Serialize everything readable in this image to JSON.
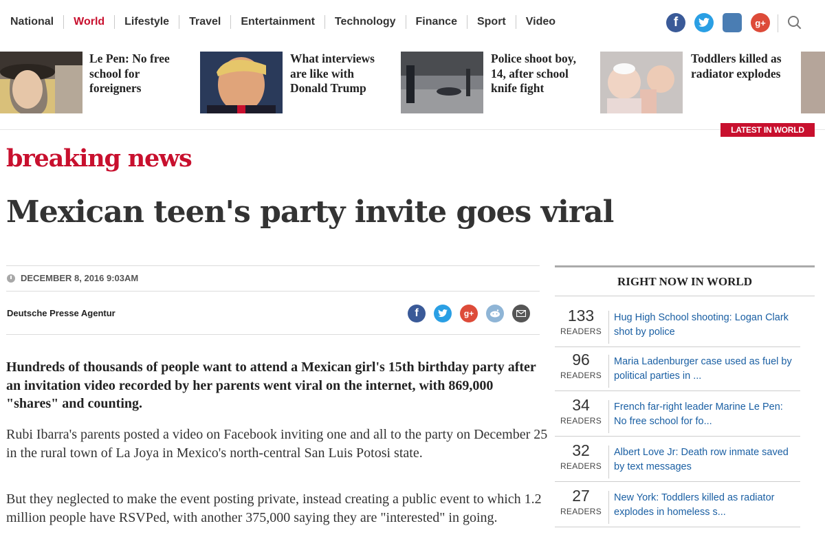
{
  "nav": {
    "items": [
      {
        "label": "National",
        "active": false
      },
      {
        "label": "World",
        "active": true
      },
      {
        "label": "Lifestyle",
        "active": false
      },
      {
        "label": "Travel",
        "active": false
      },
      {
        "label": "Entertainment",
        "active": false
      },
      {
        "label": "Technology",
        "active": false
      },
      {
        "label": "Finance",
        "active": false
      },
      {
        "label": "Sport",
        "active": false
      },
      {
        "label": "Video",
        "active": false
      }
    ],
    "social": {
      "facebook": "f",
      "twitter": "t",
      "instagram": "",
      "googleplus": "g+"
    }
  },
  "strip": {
    "stories": [
      {
        "title": "Le Pen: No free school for foreigners",
        "icon": "photo-le-pen"
      },
      {
        "title": "What interviews are like with Donald Trump",
        "icon": "photo-donald-trump"
      },
      {
        "title": "Police shoot boy, 14, after school knife fight",
        "icon": "photo-police-scene"
      },
      {
        "title": "Toddlers killed as radiator explodes",
        "icon": "photo-toddlers"
      }
    ],
    "latest_label": "LATEST IN WORLD"
  },
  "article": {
    "kicker": "breaking news",
    "headline": "Mexican teen's party invite goes viral",
    "date": "DECEMBER 8, 2016 9:03AM",
    "byline": "Deutsche Presse Agentur",
    "lede": "Hundreds of thousands of people want to attend a Mexican girl's 15th birthday party after an invitation video recorded by her parents went viral on the internet, with 869,000 \"shares\" and counting.",
    "paragraphs": [
      "Rubi Ibarra's parents posted a video on Facebook inviting one and all to the party on December 25 in the rural town of La Joya in Mexico's north-central San Luis Potosi state.",
      "But they neglected to make the event posting private, instead creating a public event to which 1.2 million people have RSVPed, with another 375,000 saying they are \"interested\" in going."
    ]
  },
  "sidebar": {
    "title": "RIGHT NOW IN WORLD",
    "readers_label": "READERS",
    "items": [
      {
        "count": "133",
        "text": "Hug High School shooting: Logan Clark shot by police"
      },
      {
        "count": "96",
        "text": "Maria Ladenburger case used as fuel by political parties in ..."
      },
      {
        "count": "34",
        "text": "French far-right leader Marine Le Pen: No free school for fo..."
      },
      {
        "count": "32",
        "text": "Albert Love Jr: Death row inmate saved by text messages"
      },
      {
        "count": "27",
        "text": "New York: Toddlers killed as radiator explodes in homeless s..."
      }
    ]
  },
  "colors": {
    "accent": "#c8102e",
    "link": "#1a5fa3"
  }
}
